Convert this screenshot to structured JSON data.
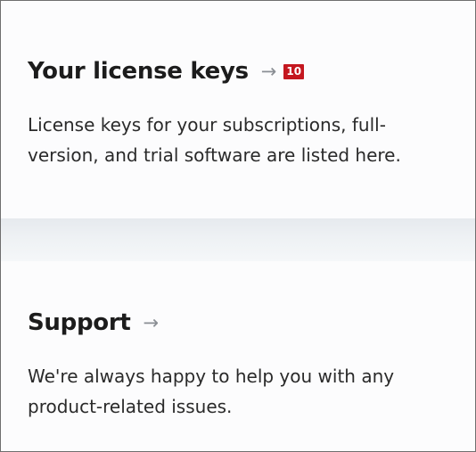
{
  "license_section": {
    "title": "Your license keys",
    "arrow": "→",
    "badge": "10",
    "description": "License keys for your subscriptions, full-version, and trial software are listed here."
  },
  "support_section": {
    "title": "Support",
    "arrow": "→",
    "description": "We're always happy to help you with any product-related issues."
  },
  "colors": {
    "badge_bg": "#c4171f",
    "arrow": "#8a8e94",
    "separator": "#e6eaee"
  }
}
